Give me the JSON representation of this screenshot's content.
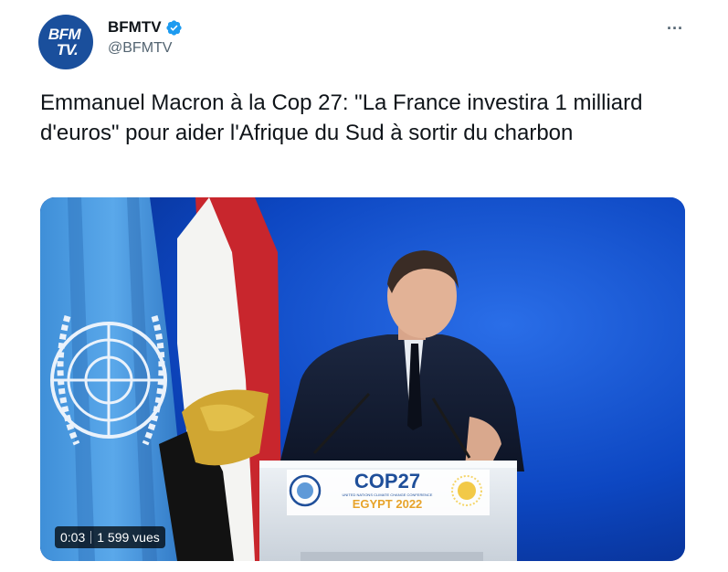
{
  "author": {
    "display_name": "BFMTV",
    "handle": "@BFMTV",
    "avatar_text_line1": "BFM",
    "avatar_text_line2": "TV.",
    "verified": true
  },
  "more_label": "···",
  "tweet": {
    "text": "Emmanuel Macron à la Cop 27: \"La France investira 1 milliard d'euros\" pour aider l'Afrique du Sud à sortir du charbon"
  },
  "media": {
    "type": "video",
    "time": "0:03",
    "views": "1 599 vues",
    "podium": {
      "logo_main": "COP27",
      "logo_sub": "EGYPT 2022",
      "logo_small": "UNITED NATIONS CLIMATE CHANGE CONFERENCE"
    }
  },
  "colors": {
    "brand_blue": "#1a4f9c",
    "verified_blue": "#1d9bf0",
    "text_primary": "#0f1419",
    "text_secondary": "#536471",
    "stage_blue": "#0a3ea8"
  }
}
